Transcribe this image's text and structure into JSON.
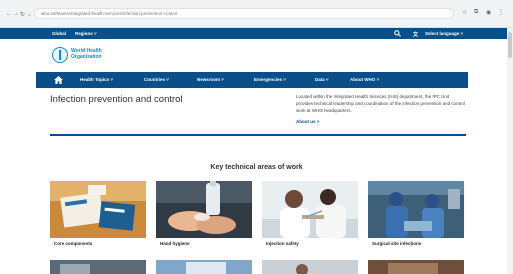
{
  "browser": {
    "url": "who.int/teams/integrated-health-services/infection-prevention-control"
  },
  "topbar": {
    "global": "Global",
    "regions": "Regions ˅",
    "select_language": "Select language ˅"
  },
  "brand": {
    "line1": "World Health",
    "line2": "Organization"
  },
  "nav": {
    "items": [
      "Health Topics ˅",
      "Countries ˅",
      "Newsroom ˅",
      "Emergencies ˅",
      "Data ˅",
      "About WHO ˅"
    ]
  },
  "page": {
    "title": "Infection prevention and control",
    "intro": "Located within the Integrated Health Services (IHS) department, the IPC Unit provides technical leadership and coordination of the infection prevention and control work at WHO headquarters.",
    "about_link": "About us >"
  },
  "section": {
    "title": "Key technical areas of work",
    "cards": [
      {
        "label": "Core components"
      },
      {
        "label": "Hand hygiene"
      },
      {
        "label": "Injection safety"
      },
      {
        "label": "Surgical site infections"
      }
    ]
  },
  "colors": {
    "brand_blue": "#0b4f8a",
    "logo_blue": "#0093d5"
  }
}
